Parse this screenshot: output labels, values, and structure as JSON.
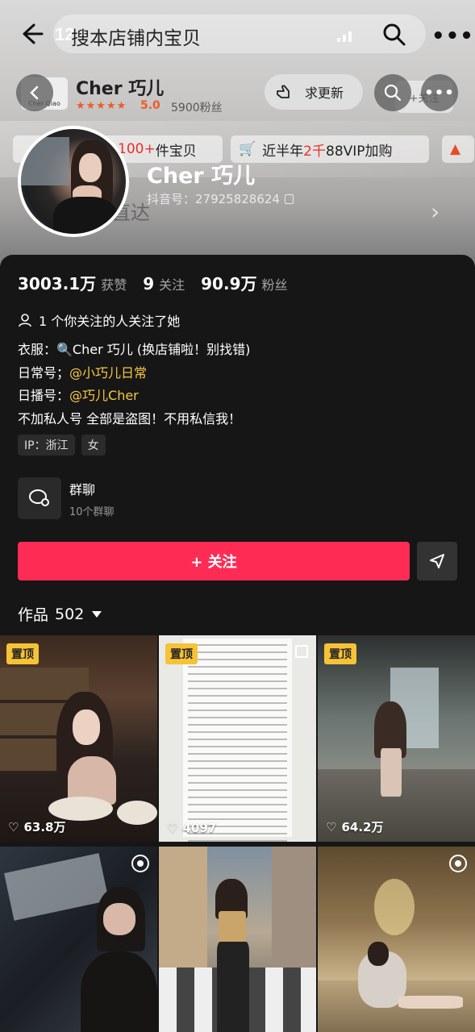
{
  "top_bar": {
    "back_icon": "back-arrow-icon",
    "time": "12",
    "search_text": "搜本店铺内宝贝",
    "search_icon": "search-icon",
    "more_icon": "more-icon"
  },
  "shop": {
    "logo_text": "Cher Qiao",
    "name": "Cher 巧儿",
    "stars": "★★★★★",
    "rating": "5.0",
    "fans": "5900粉丝",
    "update_button": "求更新",
    "follow_ghost": "+关注"
  },
  "promo": {
    "chip1_prefix": "100+",
    "chip1_suffix": "件宝贝",
    "chip2_a": "近半年",
    "chip2_b": "2千",
    "chip2_c": "88VIP加购"
  },
  "direct_text": "直达",
  "profile": {
    "name": "Cher 巧儿",
    "douyin_id": "抖音号：27925828624"
  },
  "stats": [
    {
      "value": "3003.1万",
      "label": "获赞"
    },
    {
      "value": "9",
      "label": "关注"
    },
    {
      "value": "90.9万",
      "label": "粉丝"
    }
  ],
  "mutual": "1 个你关注的人关注了她",
  "bio": {
    "line1": "衣服：🔍Cher 巧儿 (换店铺啦！别找错)",
    "line2_prefix": "日常号；",
    "line2_link": "@小巧儿日常",
    "line3_prefix": "日播号：",
    "line3_link": "@巧儿Cher",
    "line4": "不加私人号 全部是盗图！不用私信我！"
  },
  "tags": [
    "IP：浙江",
    "女"
  ],
  "group": {
    "title": "群聊",
    "subtitle": "10个群聊"
  },
  "follow_button": "+ 关注",
  "works": {
    "label": "作品",
    "count": "502"
  },
  "grid": [
    {
      "pinned": "置顶",
      "likes": "63.8万"
    },
    {
      "pinned": "置顶",
      "likes": "4097"
    },
    {
      "pinned": "置顶",
      "likes": "64.2万"
    },
    {
      "pinned": "",
      "likes": ""
    },
    {
      "pinned": "",
      "likes": ""
    },
    {
      "pinned": "",
      "likes": ""
    }
  ],
  "colors": {
    "accent": "#fe2c55",
    "link": "#f7c843",
    "pin": "#f6c336",
    "panel": "#161616"
  }
}
